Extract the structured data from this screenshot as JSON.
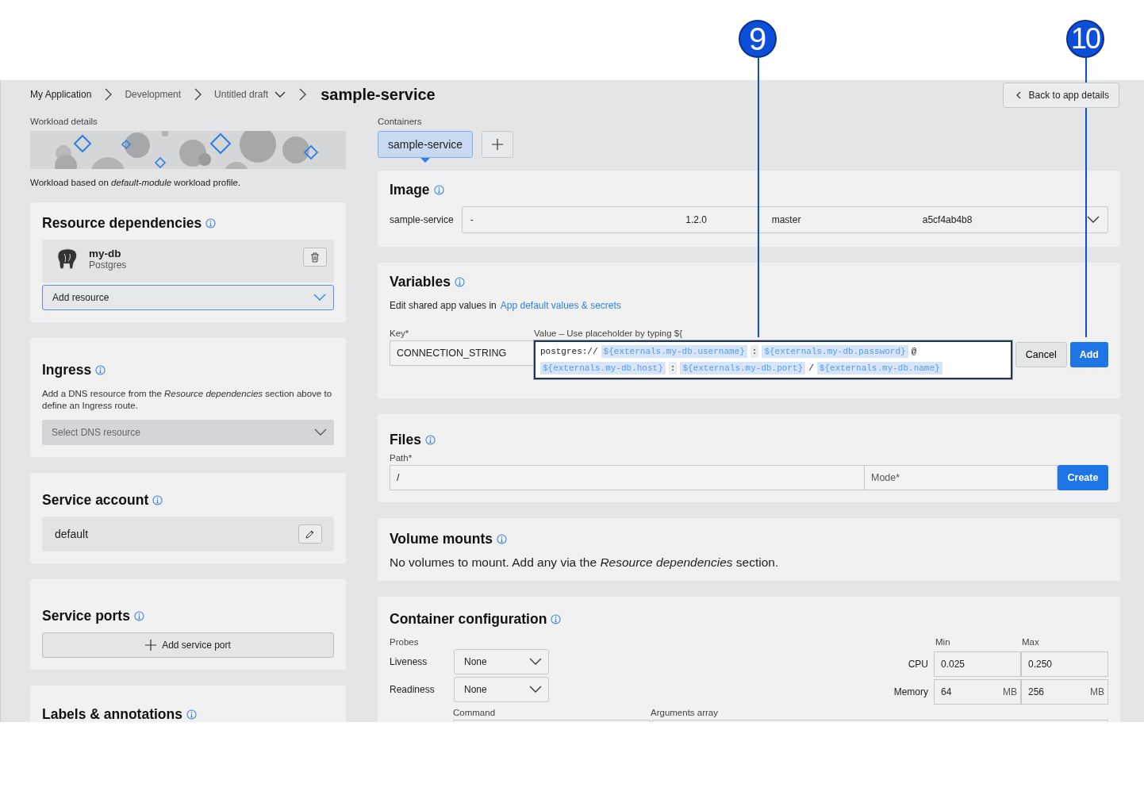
{
  "callouts": [
    "9",
    "10"
  ],
  "breadcrumb": [
    {
      "label": "My Application",
      "dropdown": false
    },
    {
      "label": "Development",
      "dropdown": false
    },
    {
      "label": "Untitled draft",
      "dropdown": true
    }
  ],
  "title": "sample-service",
  "back_button": "Back to app details",
  "workload": {
    "label": "Workload details",
    "description": "Workload based on *default-module* workload profile."
  },
  "resource_dependencies": {
    "title": "Resource dependencies",
    "items": [
      {
        "name": "my-db",
        "type": "Postgres"
      }
    ],
    "add_placeholder": "Add resource"
  },
  "ingress": {
    "title": "Ingress",
    "description": "Add a DNS resource from the *Resource dependencies* section above to define an Ingress route.",
    "select_placeholder": "Select DNS resource"
  },
  "service_account": {
    "title": "Service account",
    "value": "default"
  },
  "service_ports": {
    "title": "Service ports",
    "add_button": "Add service port"
  },
  "labels": {
    "title": "Labels & annotations"
  },
  "containers": {
    "label": "Containers",
    "tabs": [
      {
        "label": "sample-service",
        "selected": true
      }
    ]
  },
  "image": {
    "title": "Image",
    "name": "sample-service",
    "fields": [
      "-",
      "1.2.0",
      "master",
      "a5cf4ab4b8"
    ]
  },
  "variables": {
    "title": "Variables",
    "intro": "Edit shared app values in",
    "link": "App default values & secrets",
    "key_label": "Key*",
    "value_label": "Value – Use placeholder by typing ${",
    "key": "CONNECTION_STRING",
    "value_tokens": [
      {
        "kind": "text",
        "text": "postgres://"
      },
      {
        "kind": "placeholder",
        "text": "${externals.my-db.username}"
      },
      {
        "kind": "separator",
        "text": ":"
      },
      {
        "kind": "placeholder",
        "text": "${externals.my-db.password}"
      },
      {
        "kind": "text",
        "text": "@"
      },
      {
        "kind": "placeholder",
        "text": "${externals.my-db.host}"
      },
      {
        "kind": "separator",
        "text": ":"
      },
      {
        "kind": "placeholder",
        "text": "${externals.my-db.port}"
      },
      {
        "kind": "text",
        "text": "/"
      },
      {
        "kind": "placeholder",
        "text": "${externals.my-db.name}"
      }
    ],
    "cancel": "Cancel",
    "add": "Add"
  },
  "files": {
    "title": "Files",
    "path_label": "Path*",
    "path": "/",
    "mode_placeholder": "Mode*",
    "create": "Create"
  },
  "volume_mounts": {
    "title": "Volume mounts",
    "description": "No volumes to mount. Add any via the *Resource dependencies* section."
  },
  "container_configuration": {
    "title": "Container configuration",
    "probes_label": "Probes",
    "probes": [
      {
        "label": "Liveness",
        "value": "None"
      },
      {
        "label": "Readiness",
        "value": "None"
      }
    ],
    "min_label": "Min",
    "max_label": "Max",
    "resources": [
      {
        "label": "CPU",
        "min": "0.025",
        "max": "0.250"
      },
      {
        "label": "Memory",
        "min": "64",
        "max": "256",
        "min_unit": "MB",
        "max_unit": "MB"
      }
    ],
    "command_label": "Command",
    "arguments_label": "Arguments array"
  }
}
